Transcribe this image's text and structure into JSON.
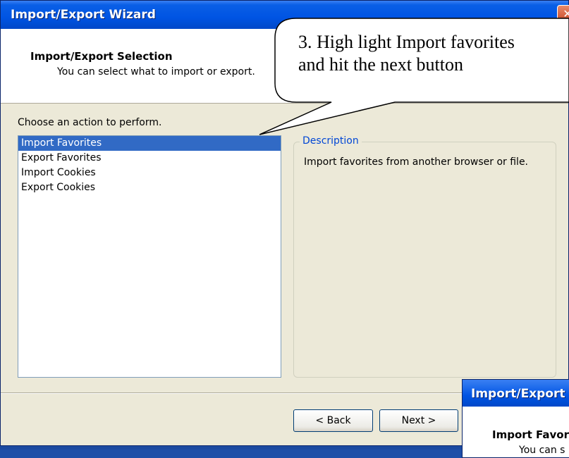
{
  "window": {
    "title": "Import/Export Wizard",
    "close_glyph": "✕"
  },
  "header": {
    "heading": "Import/Export Selection",
    "subheading": "You can select what to import or export."
  },
  "main": {
    "prompt": "Choose an action to perform.",
    "actions": [
      "Import Favorites",
      "Export Favorites",
      "Import Cookies",
      "Export Cookies"
    ],
    "selected_index": 0,
    "description": {
      "legend": "Description",
      "text": "Import favorites from another browser or file."
    }
  },
  "buttons": {
    "back_label": "< Back",
    "next_label": "Next >"
  },
  "callout": {
    "line1": "3. High light Import favorites",
    "line2": "and hit the next button"
  },
  "second_window": {
    "title": "Import/Export",
    "heading": "Import Favor",
    "subheading": "You can s"
  },
  "colors": {
    "titlebar": "#0054e3",
    "selection": "#316ac5",
    "legend": "#0046d5",
    "dialog_bg": "#ece9d8"
  }
}
